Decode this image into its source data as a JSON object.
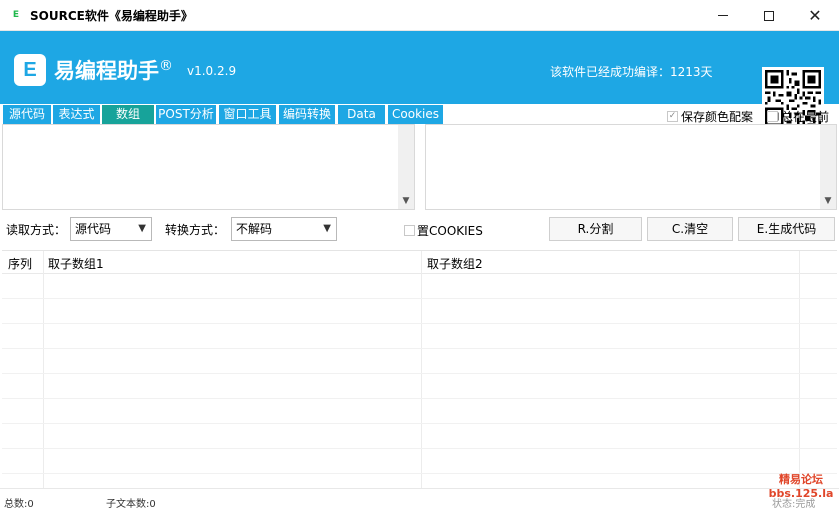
{
  "window": {
    "title": "SOURCE软件《易编程助手》",
    "icon_letter": "E"
  },
  "header": {
    "logo_letter": "E",
    "brand": "易编程助手",
    "registered": "®",
    "version": "v1.0.2.9",
    "compile_info": "该软件已经成功编译：1213天"
  },
  "tabs": [
    {
      "label": "源代码"
    },
    {
      "label": "表达式"
    },
    {
      "label": "数组",
      "active": true
    },
    {
      "label": "POST分析"
    },
    {
      "label": "窗口工具"
    },
    {
      "label": "编码转换"
    },
    {
      "label": "Data"
    },
    {
      "label": "Cookies"
    }
  ],
  "options": {
    "save_color_scheme": "保存颜色配案",
    "save_color_checked": true,
    "always_on_top": "总在最前",
    "always_on_top_checked": false
  },
  "controls": {
    "read_mode_label": "读取方式：",
    "read_mode_value": "源代码",
    "convert_mode_label": "转换方式：",
    "convert_mode_value": "不解码",
    "cookies_label": "置COOKIES",
    "split_button": "R.分割",
    "clear_button": "C.清空",
    "generate_button": "E.生成代码"
  },
  "grid": {
    "columns": [
      "序列",
      "取子数组1",
      "取子数组2"
    ],
    "rows": []
  },
  "status": {
    "total": "总数:0",
    "sub_text_count": "子文本数:0",
    "state": "状态:完成"
  },
  "watermark": {
    "line1": "精易论坛",
    "line2": "bbs.125.la"
  },
  "colors": {
    "accent": "#1ea7e4",
    "active_tab": "#17a39a"
  }
}
